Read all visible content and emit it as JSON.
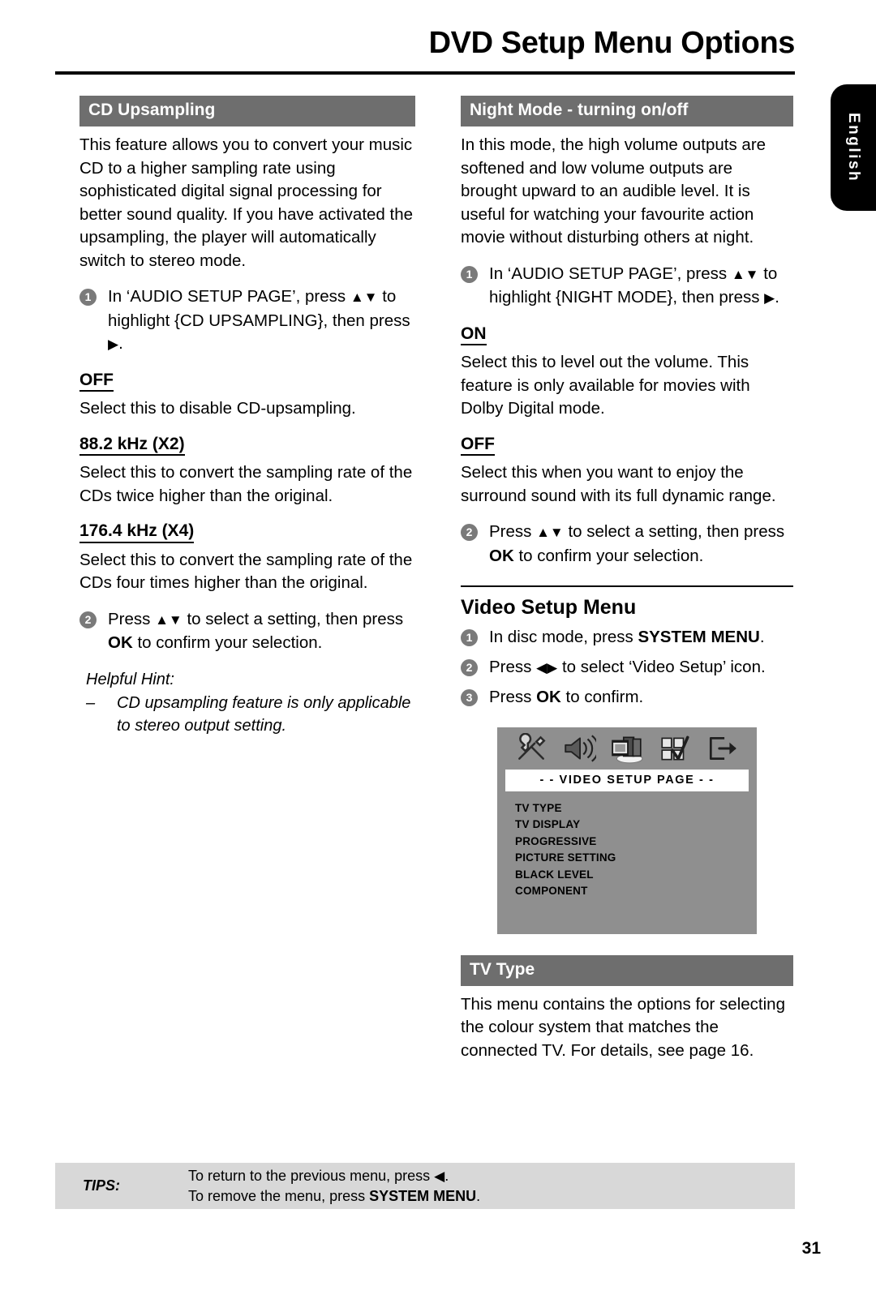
{
  "page": {
    "title": "DVD Setup Menu Options",
    "number": "31",
    "language_tab": "English"
  },
  "left_column": {
    "section": {
      "heading": "CD Upsampling",
      "intro": "This feature allows you to convert your music CD to a higher sampling rate using sophisticated digital signal processing for better sound quality. If you have activated the upsampling, the player will automatically switch to stereo mode.",
      "step1_num": "1",
      "step1_text_a": "In ‘AUDIO SETUP PAGE’, press ",
      "step1_arrows": "▲▼",
      "step1_text_b": " to highlight {CD UPSAMPLING}, then press ",
      "step1_arrow_right": "▶",
      "step1_text_c": ".",
      "options": [
        {
          "label": "OFF",
          "body": "Select this to disable CD-upsampling."
        },
        {
          "label": "88.2 kHz (X2)",
          "body": "Select this to convert the sampling rate of the CDs twice higher than the original."
        },
        {
          "label": "176.4 kHz (X4)",
          "body": "Select this to convert the sampling rate of the CDs four times higher than the original."
        }
      ],
      "step2_num": "2",
      "step2_text_a": "Press ",
      "step2_arrows": "▲▼",
      "step2_text_b": " to select a setting, then press ",
      "step2_ok": "OK",
      "step2_text_c": " to confirm your selection.",
      "hint_title": "Helpful Hint:",
      "hint_dash": "–",
      "hint_body": "CD upsampling feature is only applicable to stereo output setting."
    }
  },
  "right_column": {
    "night_mode": {
      "heading": "Night Mode - turning on/off",
      "intro": "In this mode, the high volume outputs are softened and low volume outputs are brought upward to an audible level.  It is useful for watching your favourite action movie without disturbing others at night.",
      "step1_num": "1",
      "step1_text_a": "In ‘AUDIO SETUP PAGE’, press ",
      "step1_arrows": "▲▼",
      "step1_text_b": " to highlight {NIGHT MODE}, then press ",
      "step1_arrow_right": "▶",
      "step1_text_c": ".",
      "options": [
        {
          "label": "ON",
          "body": "Select this to level out the volume. This feature is only available for movies with Dolby Digital mode."
        },
        {
          "label": "OFF",
          "body": "Select this when you want to enjoy the surround sound with its full dynamic range."
        }
      ],
      "step2_num": "2",
      "step2_text_a": "Press ",
      "step2_arrows": "▲▼",
      "step2_text_b": " to select a setting, then press ",
      "step2_ok": "OK",
      "step2_text_c": " to confirm your selection."
    },
    "video_setup": {
      "heading": "Video Setup Menu",
      "step1_num": "1",
      "step1_text_a": "In disc mode, press ",
      "step1_bold": "SYSTEM MENU",
      "step1_text_b": ".",
      "step2_num": "2",
      "step2_text_a": "Press ",
      "step2_arrows": "◀▶",
      "step2_text_b": " to select ‘Video Setup’ icon.",
      "step3_num": "3",
      "step3_text_a": "Press ",
      "step3_ok": "OK",
      "step3_text_b": " to confirm."
    },
    "osd": {
      "title": "- -  VIDEO  SETUP  PAGE  - -",
      "icons": [
        "general-setup-tools-icon",
        "audio-setup-speaker-icon",
        "video-setup-film-icon",
        "preference-grid-icon",
        "exit-setup-icon"
      ],
      "menu_items": [
        "TV TYPE",
        "TV DISPLAY",
        "PROGRESSIVE",
        "PICTURE SETTING",
        "BLACK LEVEL",
        "COMPONENT"
      ]
    },
    "tv_type": {
      "heading": "TV Type",
      "body": "This menu contains the options for selecting the colour system that matches the connected TV.  For details, see page 16."
    }
  },
  "tips": {
    "label": "TIPS:",
    "line1_a": "To return to the previous menu, press ",
    "line1_arrow": "◀",
    "line1_b": ".",
    "line2_a": "To remove the menu, press ",
    "line2_bold": "SYSTEM MENU",
    "line2_b": "."
  },
  "colors": {
    "banner_gray": "#6e6e6e",
    "osd_gray": "#8f8f8f",
    "tips_gray": "#d8d8d8",
    "step_bullet_gray": "#7a7a7a"
  }
}
